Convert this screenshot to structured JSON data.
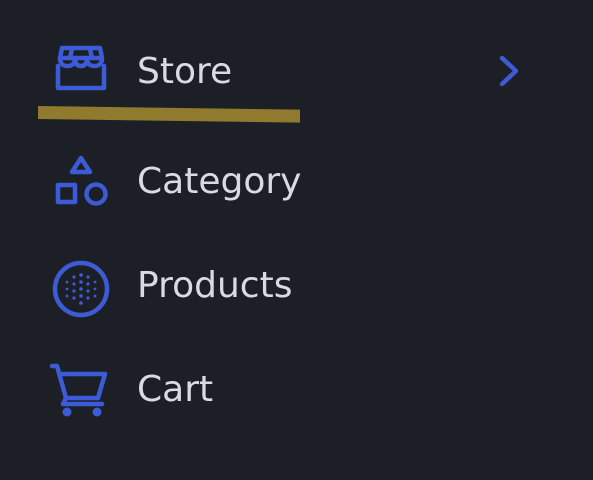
{
  "colors": {
    "background": "#1c1f26",
    "icon": "#3d5bd6",
    "text": "#d9dbe3",
    "active_underline": "#8f7a2e"
  },
  "nav": {
    "items": [
      {
        "label": "Store",
        "icon": "store-icon",
        "active": true,
        "has_submenu": true
      },
      {
        "label": "Category",
        "icon": "shapes-icon",
        "active": false,
        "has_submenu": false
      },
      {
        "label": "Products",
        "icon": "dotted-circle-icon",
        "active": false,
        "has_submenu": false
      },
      {
        "label": "Cart",
        "icon": "shopping-cart-icon",
        "active": false,
        "has_submenu": false
      }
    ]
  }
}
